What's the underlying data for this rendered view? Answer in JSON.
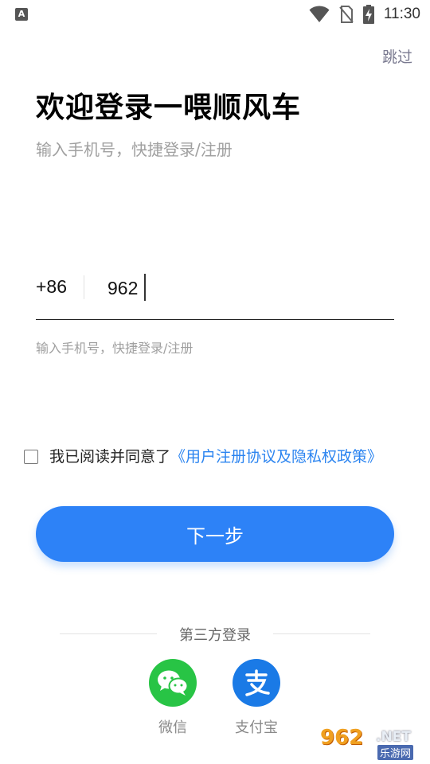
{
  "status_bar": {
    "app_badge": "A",
    "time": "11:30",
    "icons": [
      "wifi-icon",
      "no-sim-icon",
      "battery-charging-icon"
    ]
  },
  "header": {
    "skip": "跳过",
    "title": "欢迎登录一喂顺风车",
    "subtitle": "输入手机号，快捷登录/注册"
  },
  "phone": {
    "country_code": "+86",
    "value": "962",
    "hint": "输入手机号，快捷登录/注册"
  },
  "agreement": {
    "checked": false,
    "prefix": "我已阅读并同意了",
    "link": "《用户注册协议及隐私权政策》"
  },
  "next_button": "下一步",
  "third_party": {
    "title": "第三方登录",
    "options": [
      {
        "name": "微信",
        "icon": "wechat-icon",
        "color": "#28c445"
      },
      {
        "name": "支付宝",
        "icon": "alipay-icon",
        "color": "#1a7ae6"
      }
    ]
  },
  "watermark": {
    "number": "962",
    "suffix": ".NET",
    "subtitle": "乐游网"
  }
}
